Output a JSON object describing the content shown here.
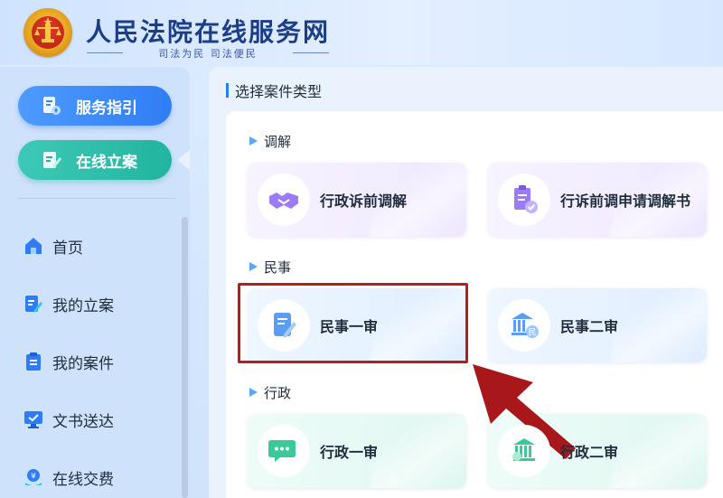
{
  "header": {
    "title": "人民法院在线服务网",
    "slogan": "司法为民  司法便民"
  },
  "sidebar": {
    "pills": [
      {
        "label": "服务指引",
        "icon": "service-guide-icon"
      },
      {
        "label": "在线立案",
        "icon": "edit-file-icon"
      }
    ],
    "items": [
      {
        "label": "首页",
        "icon": "home-icon"
      },
      {
        "label": "我的立案",
        "icon": "edit-file-icon"
      },
      {
        "label": "我的案件",
        "icon": "clipboard-icon"
      },
      {
        "label": "文书送达",
        "icon": "monitor-icon"
      },
      {
        "label": "在线交费",
        "icon": "payment-icon"
      }
    ]
  },
  "main": {
    "section_title": "选择案件类型",
    "groups": [
      {
        "label": "调解",
        "cards": [
          {
            "label": "行政诉前调解",
            "icon": "handshake-icon",
            "color": "#8b6cf0"
          },
          {
            "label": "行诉前调申请调解书",
            "icon": "document-check-icon",
            "color": "#8b6cf0"
          }
        ]
      },
      {
        "label": "民事",
        "cards": [
          {
            "label": "民事一审",
            "icon": "document-edit-icon",
            "color": "#4f8ff7"
          },
          {
            "label": "民事二审",
            "icon": "courthouse-icon",
            "color": "#4f8ff7"
          }
        ]
      },
      {
        "label": "行政",
        "cards": [
          {
            "label": "行政一审",
            "icon": "chat-bubble-icon",
            "color": "#2bbf8c"
          },
          {
            "label": "行政二审",
            "icon": "courthouse-icon",
            "color": "#2bbf8c"
          }
        ]
      }
    ]
  },
  "annotation": {
    "highlight_color": "#b41e1e",
    "arrow_color": "#a8181b"
  }
}
